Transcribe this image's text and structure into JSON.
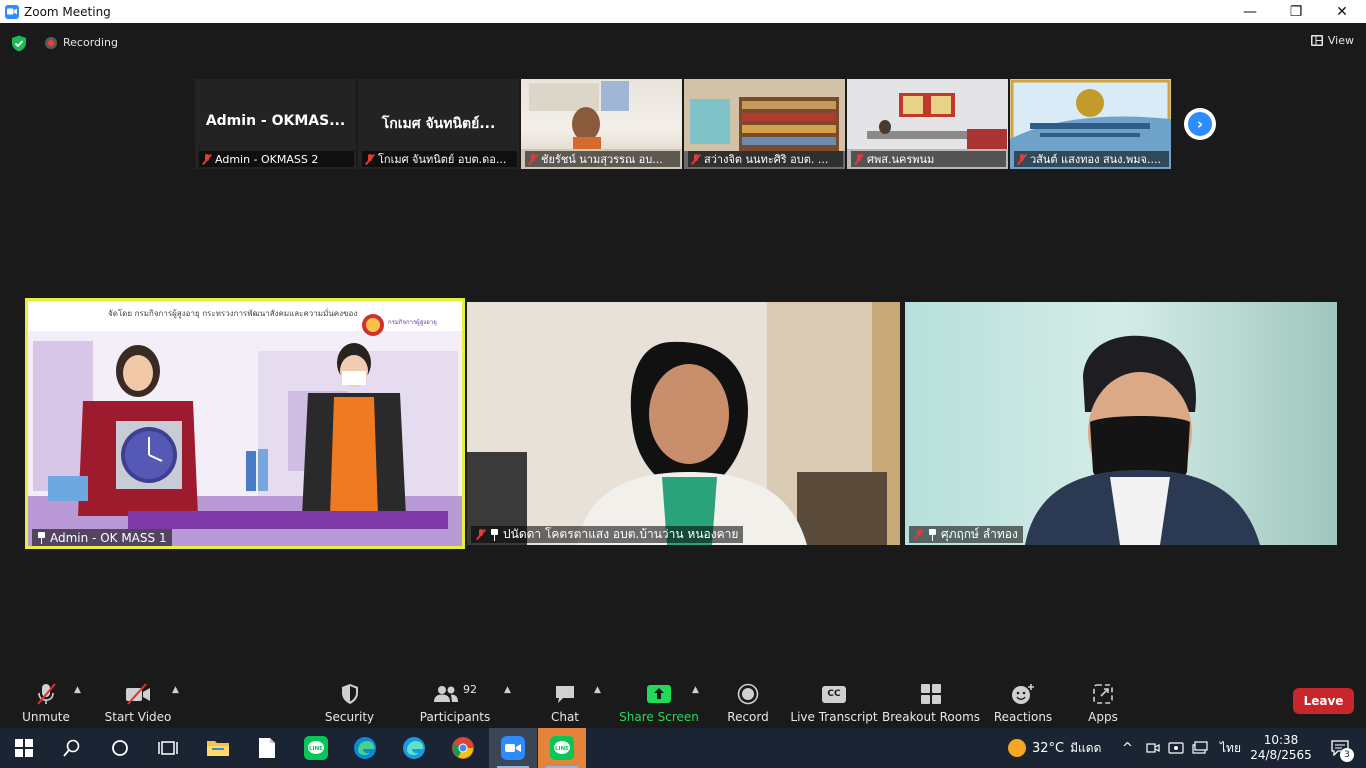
{
  "window": {
    "title": "Zoom Meeting",
    "controls": {
      "minimize": "—",
      "maximize": "❐",
      "close": "✕"
    }
  },
  "topbar": {
    "recording_label": "Recording",
    "view_label": "View"
  },
  "thumbnails": [
    {
      "display_name": "Admin - OKMAS...",
      "label": "Admin - OKMASS 2",
      "video": false
    },
    {
      "display_name": "โกเมศ จันทนิตย์...",
      "label": "โกเมศ จันทนิตย์ อบต.ดอ...",
      "video": false
    },
    {
      "label": "ชัยรัชน์ นามสุวรรณ อบ...",
      "video": true
    },
    {
      "label": "สว่างจิต นนทะศิริ อบต. ...",
      "video": true
    },
    {
      "label": "ศพส.นครพนม",
      "video": true
    },
    {
      "label": "วสันต์ แสงทอง สนง.พมจ....",
      "video": true
    }
  ],
  "tiles": [
    {
      "label": "Admin - OK MASS 1",
      "banner_text": "จัดโดย กรมกิจการผู้สูงอายุ กระทรวงการพัฒนาสังคมและความมั่นคงของมนุษย์",
      "logo_text": "กรมกิจการผู้สูงอายุ",
      "active_speaker": true
    },
    {
      "label": "ปนัดดา โคตรตาแสง อบต.บ้านว่าน หนองคาย"
    },
    {
      "label": "ศุภฤกษ์ ลำทอง"
    }
  ],
  "toolbar": {
    "unmute": "Unmute",
    "start_video": "Start Video",
    "security": "Security",
    "participants": "Participants",
    "participants_count": "92",
    "chat": "Chat",
    "share_screen": "Share Screen",
    "record": "Record",
    "live_transcript": "Live Transcript",
    "live_transcript_badge": "CC",
    "breakout_rooms": "Breakout Rooms",
    "reactions": "Reactions",
    "apps": "Apps",
    "leave": "Leave"
  },
  "taskbar": {
    "apps": [
      "start",
      "search",
      "cortana",
      "task-view",
      "file-explorer",
      "notepad",
      "line",
      "edge",
      "edge-beta",
      "chrome",
      "zoom",
      "line-2"
    ],
    "weather_temp": "32°C",
    "weather_desc": "มีแดด",
    "language": "ไทย",
    "time": "10:38",
    "date": "24/8/2565",
    "notification_count": "3"
  },
  "colors": {
    "accent_blue": "#2d8cff",
    "leave_red": "#c7262b",
    "share_green": "#23d959",
    "active_speaker_border": "#e6f03c"
  }
}
